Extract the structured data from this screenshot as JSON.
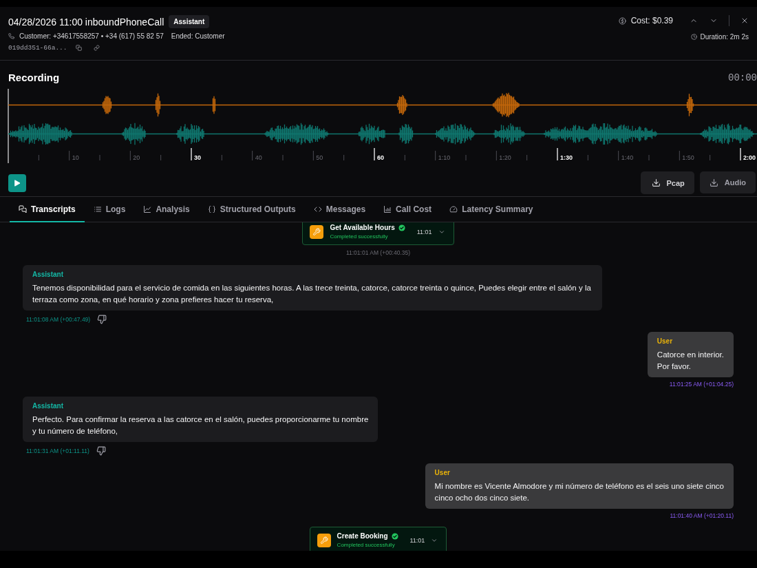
{
  "header": {
    "title": "04/28/2026 11:00 inboundPhoneCall",
    "badge": "Assistant",
    "customer": "Customer: +34617558257 • +34 (617) 55 82 57",
    "ended": "Ended: Customer",
    "call_id": "019dd351-66a...",
    "cost": "Cost: $0.39",
    "duration": "Duration: 2m 2s"
  },
  "recording": {
    "title": "Recording",
    "time": "00:00",
    "timeline": [
      {
        "label": "10",
        "major": false
      },
      {
        "label": "20",
        "major": false
      },
      {
        "label": "30",
        "major": true
      },
      {
        "label": "40",
        "major": false
      },
      {
        "label": "50",
        "major": false
      },
      {
        "label": "60",
        "major": true
      },
      {
        "label": "1:10",
        "major": false
      },
      {
        "label": "1:20",
        "major": false
      },
      {
        "label": "1:30",
        "major": true
      },
      {
        "label": "1:40",
        "major": false
      },
      {
        "label": "1:50",
        "major": false
      },
      {
        "label": "2:00",
        "major": true
      }
    ],
    "buttons": [
      "Pcap",
      "Audio"
    ]
  },
  "tabs": [
    {
      "label": "Transcripts",
      "selected": true
    },
    {
      "label": "Logs",
      "selected": false
    },
    {
      "label": "Analysis",
      "selected": false
    },
    {
      "label": "Structured Outputs",
      "selected": false
    },
    {
      "label": "Messages",
      "selected": false
    },
    {
      "label": "Call Cost",
      "selected": false
    },
    {
      "label": "Latency Summary",
      "selected": false
    }
  ],
  "transcript": [
    {
      "kind": "tool",
      "name": "Get Available Hours",
      "status": "Completed successfully",
      "time": "11:01",
      "timestamp": "11:01:01 AM (+00:40.35)"
    },
    {
      "kind": "assistant",
      "role": "Assistant",
      "text": "Tenemos disponibilidad para el servicio de comida en las siguientes horas. A las trece treinta, catorce, catorce treinta o quince, Puedes elegir entre el salón y la terraza como zona, en qué horario y zona prefieres hacer tu reserva,",
      "timestamp": "11:01:08 AM (+00:47.49)"
    },
    {
      "kind": "user",
      "role": "User",
      "text": "Catorce en interior.\nPor favor.",
      "timestamp": "11:01:25 AM (+01:04.25)"
    },
    {
      "kind": "assistant",
      "role": "Assistant",
      "text": "Perfecto. Para confirmar la reserva a las catorce en el salón, puedes proporcionarme tu nombre\ny tu número de teléfono,",
      "timestamp": "11:01:31 AM (+01:11.11)"
    },
    {
      "kind": "user",
      "role": "User",
      "text": "Mi nombre es Vicente Almodore y mi número de teléfono es el seis uno siete cinco\ncinco ocho dos cinco siete.",
      "timestamp": "11:01:40 AM (+01:20.11)"
    },
    {
      "kind": "tool",
      "name": "Create Booking",
      "status": "Completed successfully",
      "time": "11:01"
    }
  ]
}
